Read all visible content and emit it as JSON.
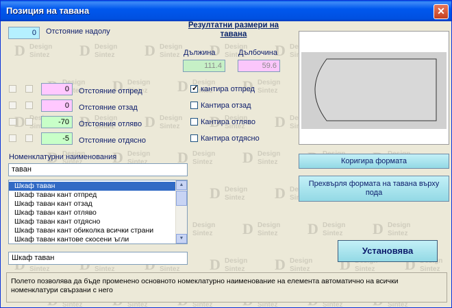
{
  "window": {
    "title": "Позиция на тавана",
    "close_label": "✕"
  },
  "watermark": {
    "big": "D",
    "word1": "Design",
    "word2": "Sintez"
  },
  "results": {
    "heading": "Резултатни размери на тавана",
    "length_label": "Дължина",
    "depth_label": "Дълбочина",
    "length_value": "111.4",
    "depth_value": "59.6"
  },
  "offset_down": {
    "label": "Отстояние надолу",
    "value": "0"
  },
  "offsets": [
    {
      "label": "Отстояние отпред",
      "value": "0",
      "color": "#ffc8ff"
    },
    {
      "label": "Отстояние отзад",
      "value": "0",
      "color": "#ffc8ff"
    },
    {
      "label": "Отстояния отляво",
      "value": "-70",
      "color": "#c8ffc8"
    },
    {
      "label": "Отстояние отдясно",
      "value": "-5",
      "color": "#c8ffc8"
    }
  ],
  "edging": [
    {
      "label": "кантира отпред",
      "checked": true
    },
    {
      "label": "Кантира отзад",
      "checked": false
    },
    {
      "label": "Кантира отляво",
      "checked": false
    },
    {
      "label": "Кантира отдясно",
      "checked": false
    }
  ],
  "nomenclature": {
    "label": "Номенклатурни наименования",
    "input_value": "таван",
    "items": [
      "Шкаф таван",
      "Шкаф таван кант отпред",
      "Шкаф таван кант отзад",
      "Шкаф таван кант отляво",
      "Шкаф таван кант отдясно",
      "Шкаф таван кант обиколка всички страни",
      "Шкаф таван кантове скосени ъгли"
    ],
    "selected_index": 0,
    "selected_value": "Шкаф таван"
  },
  "buttons": {
    "fix_shape": "Коригира формата",
    "transfer_shape": "Прехвърля формата на тавана върху пода",
    "apply": "Установява"
  },
  "status": {
    "text": "Полето позволява да бъде променено основното номеклатурно наименование на елемента автоматично на всички номенклатури свързани с него"
  },
  "colors": {
    "titlebar": "#0058ee",
    "cyan_field": "#b5f0ff",
    "button_cyan": "#a8e4ee",
    "selection": "#316ac5"
  }
}
